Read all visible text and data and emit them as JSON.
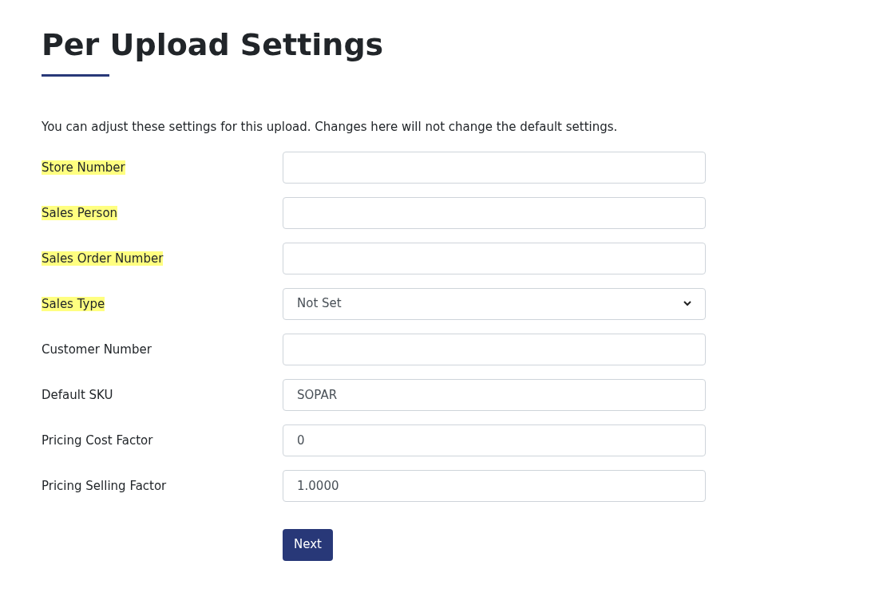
{
  "title": "Per Upload Settings",
  "intro": "You can adjust these settings for this upload. Changes here will not change the default settings.",
  "fields": [
    {
      "label": "Store Number",
      "highlighted": true,
      "kind": "text"
    },
    {
      "label": "Sales Person",
      "highlighted": true,
      "kind": "text"
    },
    {
      "label": "Sales Order Number",
      "highlighted": true,
      "kind": "text"
    },
    {
      "label": "Sales Type",
      "highlighted": true,
      "kind": "select",
      "value": "Not Set"
    },
    {
      "label": "Customer Number",
      "highlighted": false,
      "kind": "text"
    },
    {
      "label": "Default SKU",
      "highlighted": false,
      "kind": "text",
      "value": "SOPAR"
    },
    {
      "label": "Pricing Cost Factor",
      "highlighted": false,
      "kind": "text",
      "value": "0"
    },
    {
      "label": "Pricing Selling Factor",
      "highlighted": false,
      "kind": "text",
      "value": "1.0000"
    }
  ],
  "button": "Next"
}
